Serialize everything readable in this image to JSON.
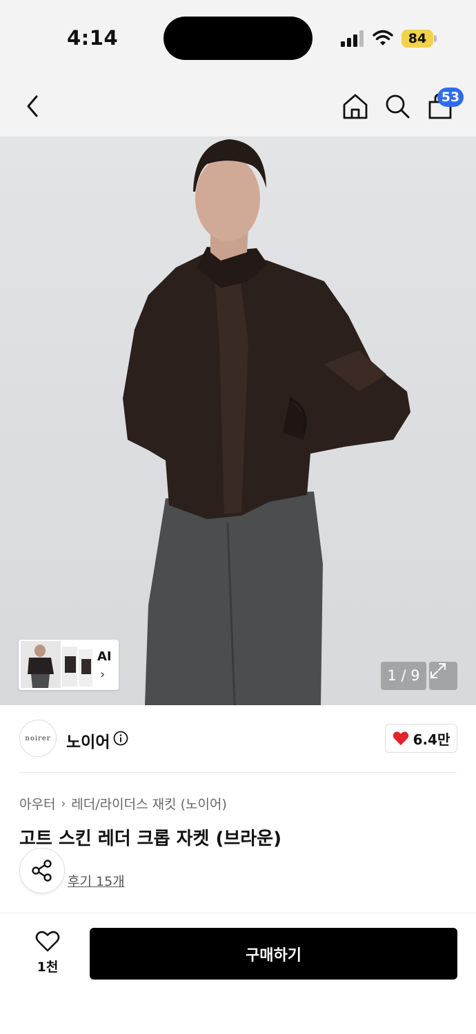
{
  "status_bar": {
    "time": "4:14",
    "battery": "84"
  },
  "nav": {
    "cart_badge": "53",
    "icons": [
      "back-icon",
      "home-icon",
      "search-icon",
      "shopping-bag-icon"
    ]
  },
  "gallery": {
    "counter": "1 / 9",
    "ai_label": "AI",
    "ai_chevron": "›"
  },
  "brand": {
    "logo_text": "noirer",
    "name": "노이어",
    "like_count": "6.4만"
  },
  "breadcrumb": {
    "category": "아우터",
    "separator": "›",
    "subcategory": "레더/라이더스 재킷 (노이어)"
  },
  "product": {
    "title": "고트 스킨 레더 크롭 자켓 (브라운)",
    "review_link": "후기 15개"
  },
  "bottom_bar": {
    "wish_count": "1천",
    "buy_label": "구매하기"
  },
  "colors": {
    "accent_blue": "#2e6bf0",
    "like_red": "#e5232d",
    "buy_button": "#000000"
  }
}
